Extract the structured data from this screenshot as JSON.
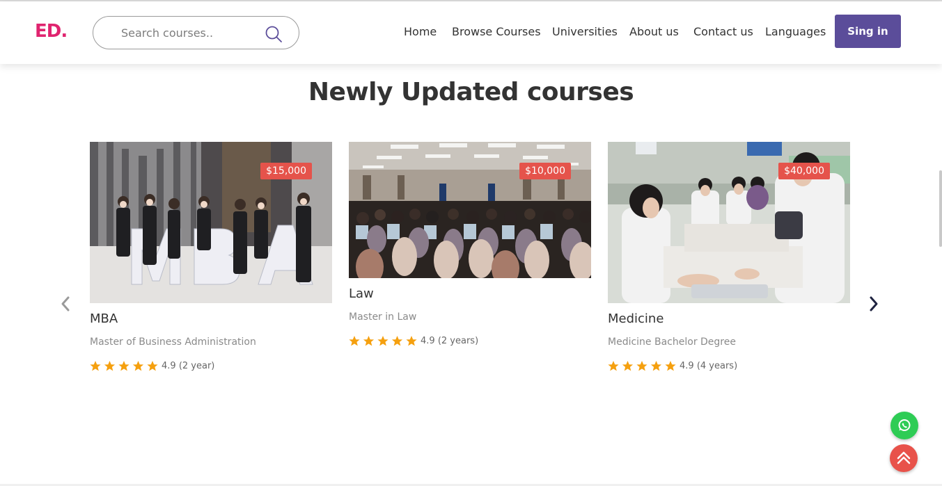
{
  "header": {
    "logo": "ED",
    "search": {
      "placeholder": "Search courses.."
    },
    "nav": [
      {
        "label": "Home"
      },
      {
        "label": "Browse Courses"
      },
      {
        "label": "Universities"
      },
      {
        "label": "About us"
      },
      {
        "label": "Contact us"
      },
      {
        "label": "Languages"
      }
    ],
    "signin_label": "Sing in"
  },
  "section": {
    "title": "Newly Updated courses"
  },
  "courses": [
    {
      "price": "$15,000",
      "title": "MBA",
      "subtitle": "Master of Business Administration",
      "rating": "4.9",
      "duration": "(2 year)",
      "stars": 5,
      "image_letters": [
        "M",
        "B",
        "A"
      ]
    },
    {
      "price": "$10,000",
      "title": "Law",
      "subtitle": "Master in Law",
      "rating": "4.9",
      "duration": "(2 years)",
      "stars": 5
    },
    {
      "price": "$40,000",
      "title": "Medicine",
      "subtitle": "Medicine Bachelor Degree",
      "rating": "4.9",
      "duration": "(4 years)",
      "stars": 5
    }
  ],
  "colors": {
    "brand": "#e0246f",
    "signin_bg": "#5b4d9a",
    "price_badge": "#e5534b",
    "star": "#f5a00f",
    "whatsapp": "#2ecc55",
    "scroll_top": "#e8524a"
  },
  "icons": [
    "search-icon",
    "chevron-left-icon",
    "chevron-right-icon",
    "star-icon",
    "whatsapp-icon",
    "chevrons-up-icon"
  ]
}
